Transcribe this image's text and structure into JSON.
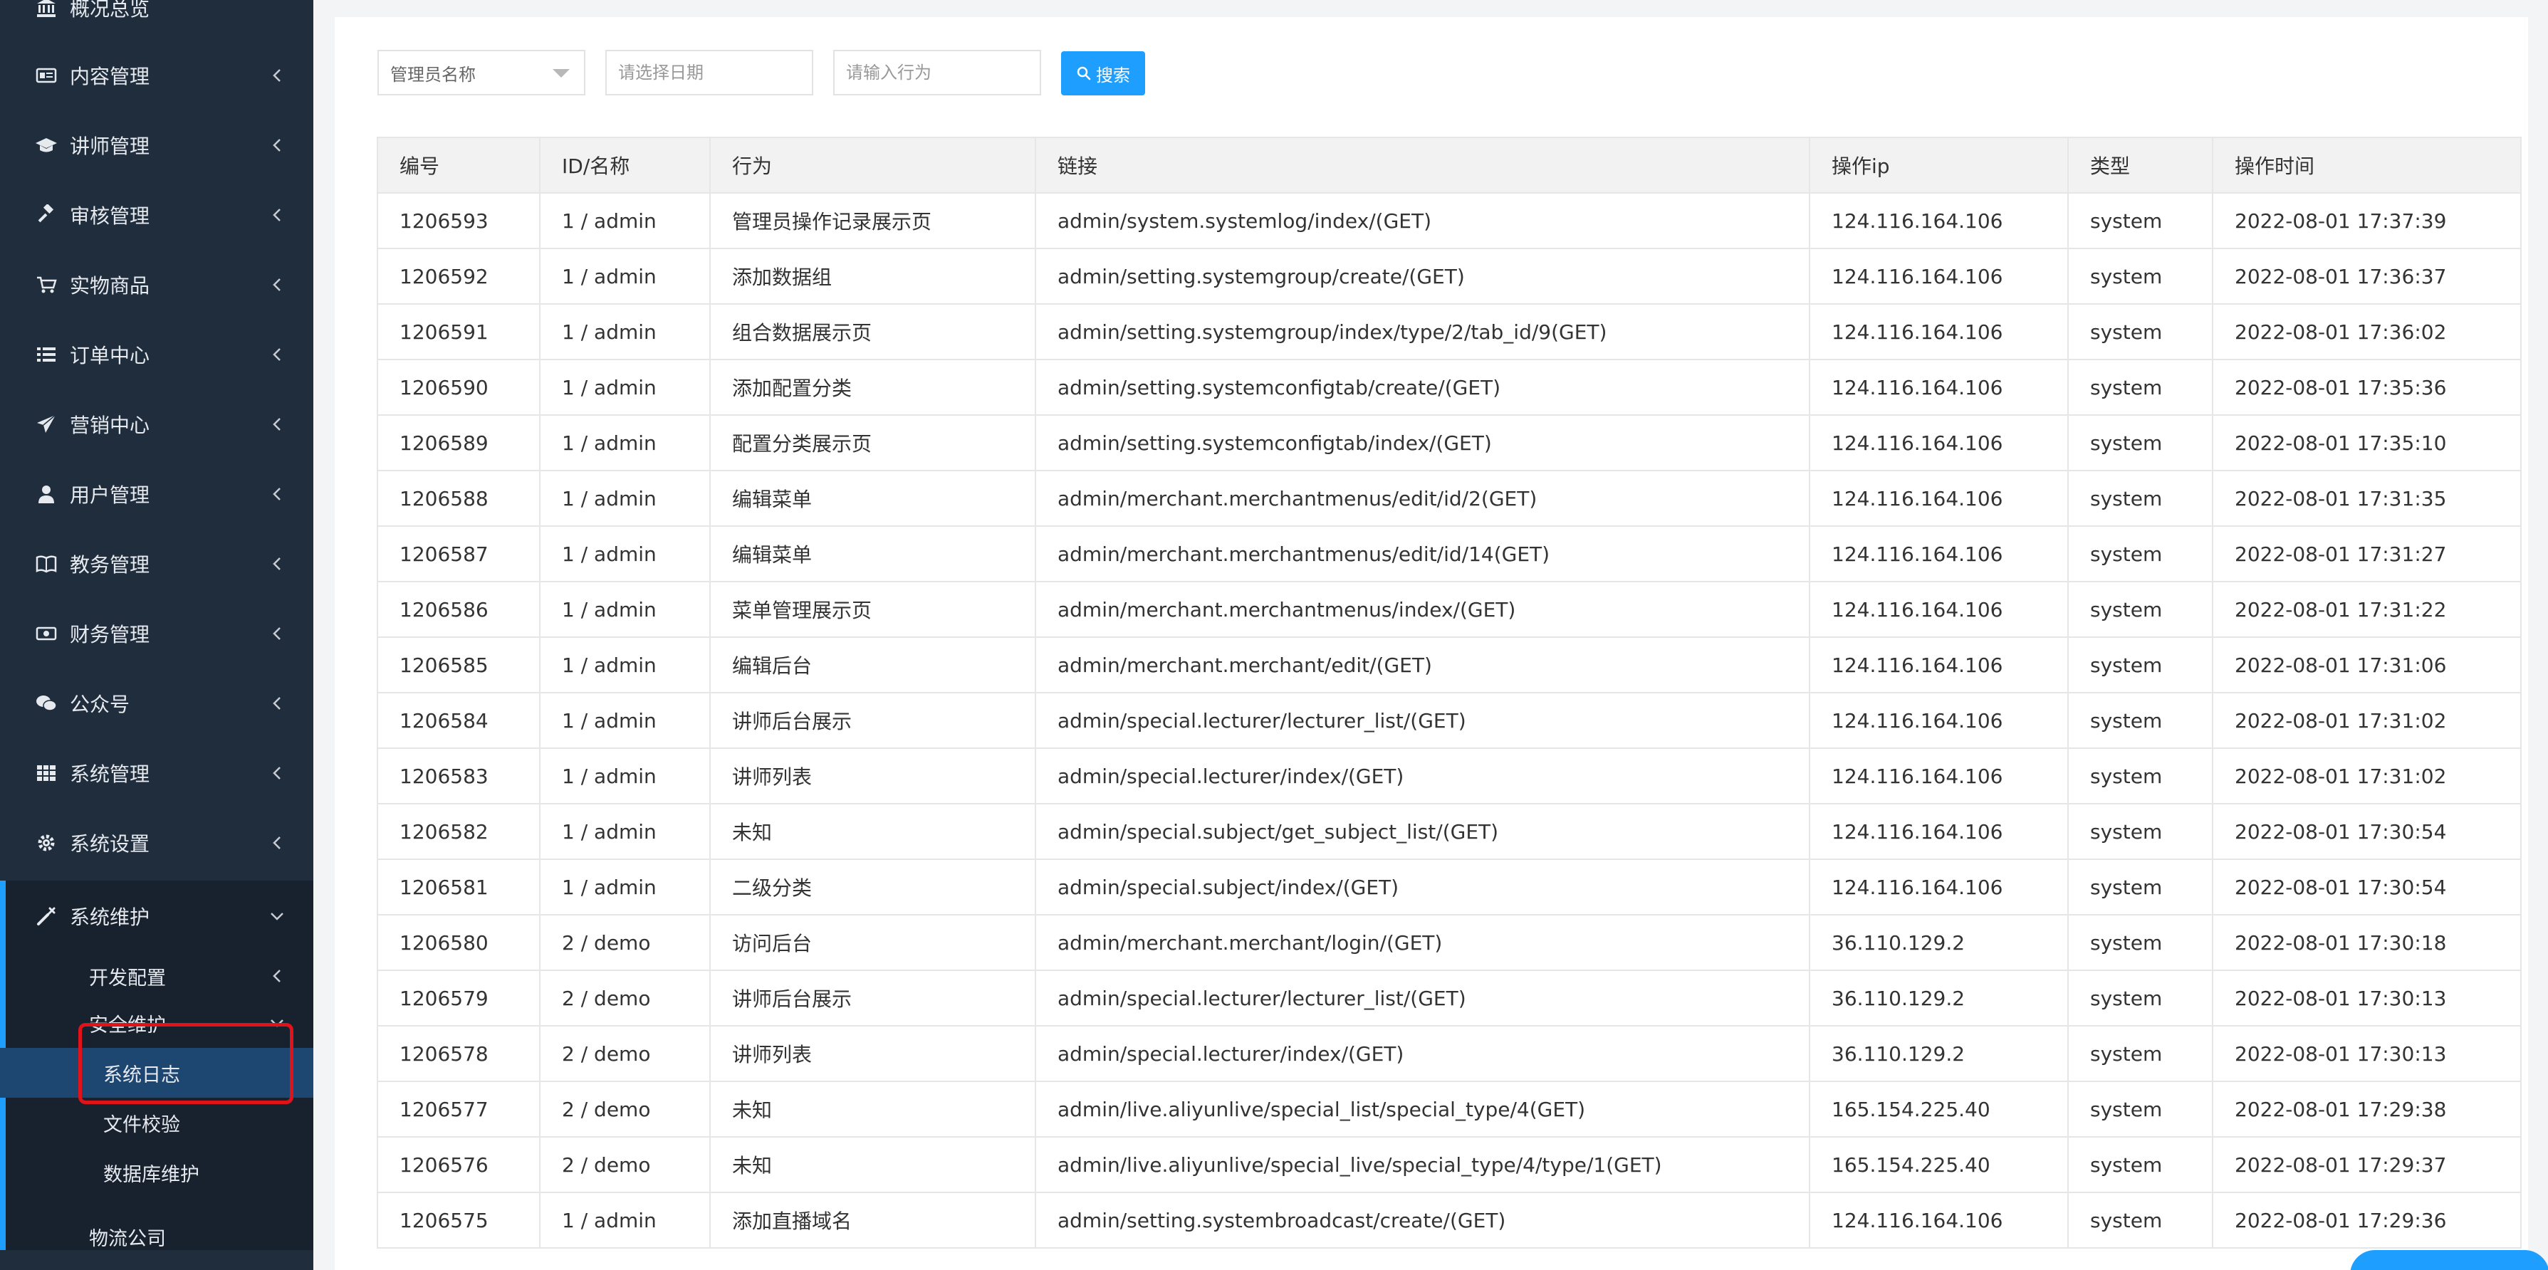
{
  "sidebar": {
    "items": [
      {
        "label": "概况总览",
        "icon": "bank-icon"
      },
      {
        "label": "内容管理",
        "icon": "card-icon"
      },
      {
        "label": "讲师管理",
        "icon": "graduation-cap-icon"
      },
      {
        "label": "审核管理",
        "icon": "gavel-icon"
      },
      {
        "label": "实物商品",
        "icon": "cart-icon"
      },
      {
        "label": "订单中心",
        "icon": "list-icon"
      },
      {
        "label": "营销中心",
        "icon": "paper-plane-icon"
      },
      {
        "label": "用户管理",
        "icon": "user-icon"
      },
      {
        "label": "教务管理",
        "icon": "book-icon"
      },
      {
        "label": "财务管理",
        "icon": "money-icon"
      },
      {
        "label": "公众号",
        "icon": "wechat-icon"
      },
      {
        "label": "系统管理",
        "icon": "grid-icon"
      },
      {
        "label": "系统设置",
        "icon": "gear-icon"
      },
      {
        "label": "系统维护",
        "icon": "wrench-icon"
      }
    ],
    "sub": {
      "dev_config": "开发配置",
      "security": "安全维护",
      "system_log": "系统日志",
      "file_check": "文件校验",
      "db_maintain": "数据库维护",
      "logistics": "物流公司"
    }
  },
  "filters": {
    "admin_select": "管理员名称",
    "date_placeholder": "请选择日期",
    "action_placeholder": "请输入行为",
    "search_label": "搜索"
  },
  "table": {
    "headers": [
      "编号",
      "ID/名称",
      "行为",
      "链接",
      "操作ip",
      "类型",
      "操作时间"
    ],
    "rows": [
      [
        "1206593",
        "1 / admin",
        "管理员操作记录展示页",
        "admin/system.systemlog/index/(GET)",
        "124.116.164.106",
        "system",
        "2022-08-01 17:37:39"
      ],
      [
        "1206592",
        "1 / admin",
        "添加数据组",
        "admin/setting.systemgroup/create/(GET)",
        "124.116.164.106",
        "system",
        "2022-08-01 17:36:37"
      ],
      [
        "1206591",
        "1 / admin",
        "组合数据展示页",
        "admin/setting.systemgroup/index/type/2/tab_id/9(GET)",
        "124.116.164.106",
        "system",
        "2022-08-01 17:36:02"
      ],
      [
        "1206590",
        "1 / admin",
        "添加配置分类",
        "admin/setting.systemconfigtab/create/(GET)",
        "124.116.164.106",
        "system",
        "2022-08-01 17:35:36"
      ],
      [
        "1206589",
        "1 / admin",
        "配置分类展示页",
        "admin/setting.systemconfigtab/index/(GET)",
        "124.116.164.106",
        "system",
        "2022-08-01 17:35:10"
      ],
      [
        "1206588",
        "1 / admin",
        "编辑菜单",
        "admin/merchant.merchantmenus/edit/id/2(GET)",
        "124.116.164.106",
        "system",
        "2022-08-01 17:31:35"
      ],
      [
        "1206587",
        "1 / admin",
        "编辑菜单",
        "admin/merchant.merchantmenus/edit/id/14(GET)",
        "124.116.164.106",
        "system",
        "2022-08-01 17:31:27"
      ],
      [
        "1206586",
        "1 / admin",
        "菜单管理展示页",
        "admin/merchant.merchantmenus/index/(GET)",
        "124.116.164.106",
        "system",
        "2022-08-01 17:31:22"
      ],
      [
        "1206585",
        "1 / admin",
        "编辑后台",
        "admin/merchant.merchant/edit/(GET)",
        "124.116.164.106",
        "system",
        "2022-08-01 17:31:06"
      ],
      [
        "1206584",
        "1 / admin",
        "讲师后台展示",
        "admin/special.lecturer/lecturer_list/(GET)",
        "124.116.164.106",
        "system",
        "2022-08-01 17:31:02"
      ],
      [
        "1206583",
        "1 / admin",
        "讲师列表",
        "admin/special.lecturer/index/(GET)",
        "124.116.164.106",
        "system",
        "2022-08-01 17:31:02"
      ],
      [
        "1206582",
        "1 / admin",
        "未知",
        "admin/special.subject/get_subject_list/(GET)",
        "124.116.164.106",
        "system",
        "2022-08-01 17:30:54"
      ],
      [
        "1206581",
        "1 / admin",
        "二级分类",
        "admin/special.subject/index/(GET)",
        "124.116.164.106",
        "system",
        "2022-08-01 17:30:54"
      ],
      [
        "1206580",
        "2 / demo",
        "访问后台",
        "admin/merchant.merchant/login/(GET)",
        "36.110.129.2",
        "system",
        "2022-08-01 17:30:18"
      ],
      [
        "1206579",
        "2 / demo",
        "讲师后台展示",
        "admin/special.lecturer/lecturer_list/(GET)",
        "36.110.129.2",
        "system",
        "2022-08-01 17:30:13"
      ],
      [
        "1206578",
        "2 / demo",
        "讲师列表",
        "admin/special.lecturer/index/(GET)",
        "36.110.129.2",
        "system",
        "2022-08-01 17:30:13"
      ],
      [
        "1206577",
        "2 / demo",
        "未知",
        "admin/live.aliyunlive/special_list/special_type/4(GET)",
        "165.154.225.40",
        "system",
        "2022-08-01 17:29:38"
      ],
      [
        "1206576",
        "2 / demo",
        "未知",
        "admin/live.aliyunlive/special_live/special_type/4/type/1(GET)",
        "165.154.225.40",
        "system",
        "2022-08-01 17:29:37"
      ],
      [
        "1206575",
        "1 / admin",
        "添加直播域名",
        "admin/setting.systembroadcast/create/(GET)",
        "124.116.164.106",
        "system",
        "2022-08-01 17:29:36"
      ]
    ]
  },
  "colors": {
    "sidebar_bg": "#1f2d3d",
    "accent": "#1E9FFF",
    "highlight_border": "#e0131b"
  }
}
